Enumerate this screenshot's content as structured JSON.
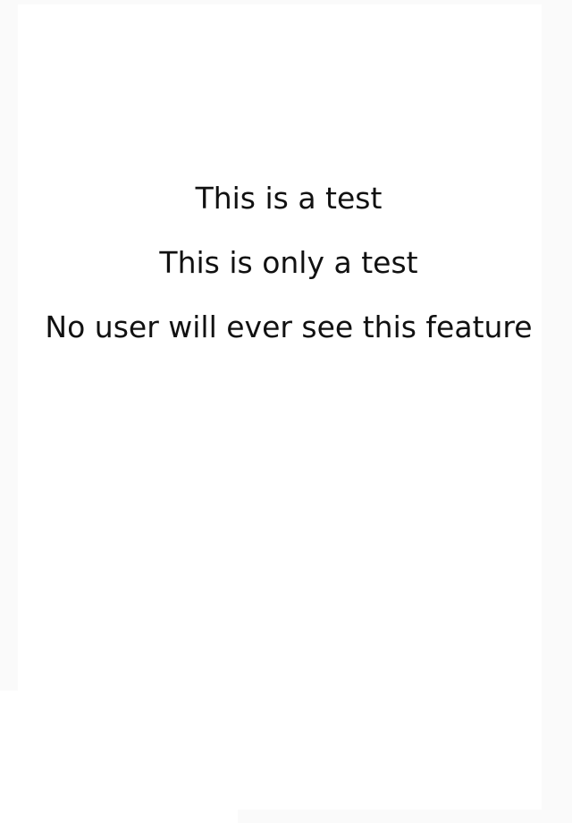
{
  "messages": [
    "This is a test",
    "This is only a test",
    "No user will ever see this feature"
  ]
}
